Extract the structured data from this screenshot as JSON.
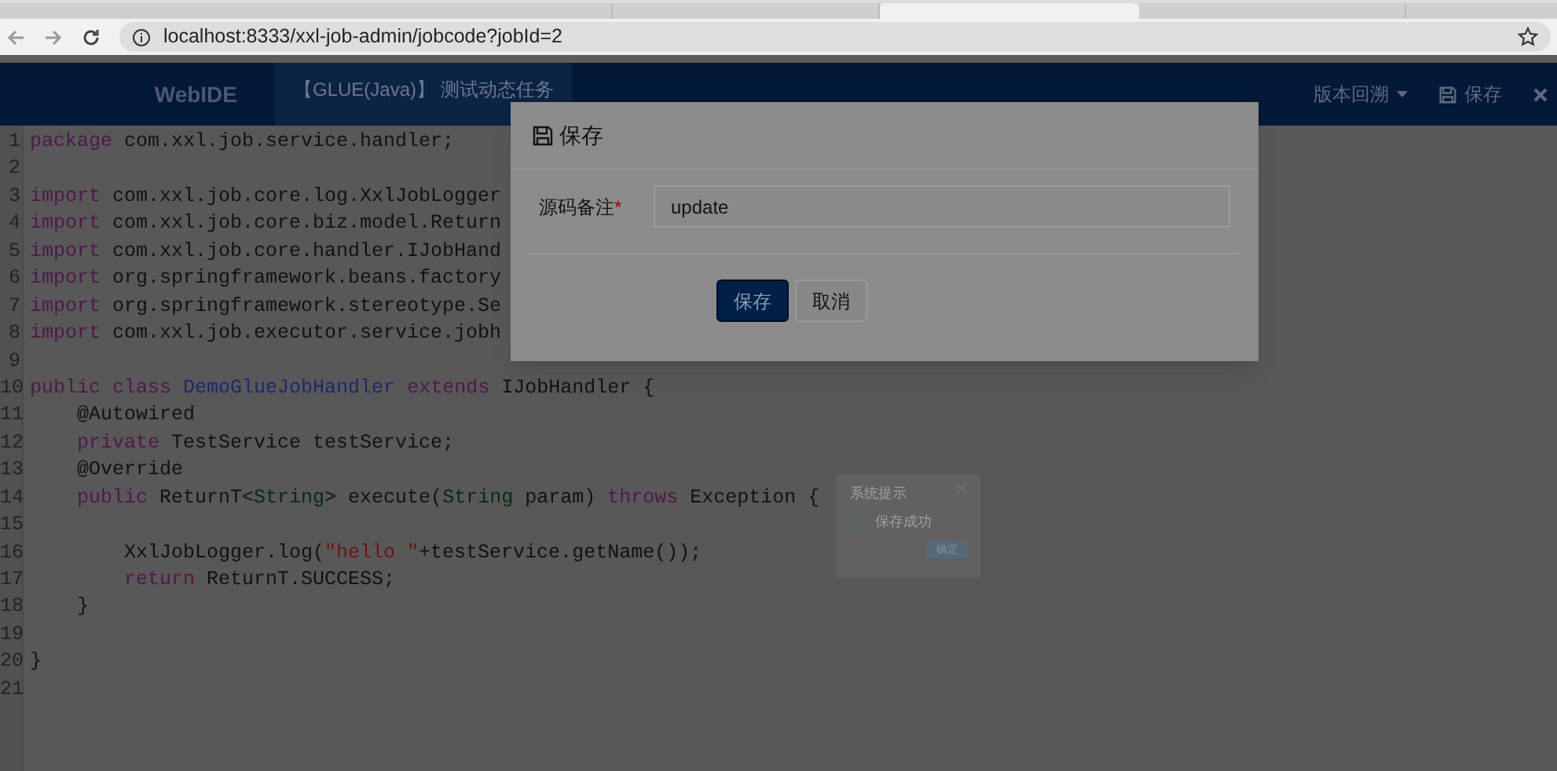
{
  "browser": {
    "url": "localhost:8333/xxl-job-admin/jobcode?jobId=2"
  },
  "header": {
    "brand": "WebIDE",
    "job_title": "【GLUE(Java)】 测试动态任务",
    "actions": [
      {
        "kind": "dropdown",
        "label": "版本回溯"
      },
      {
        "kind": "save",
        "label": "保存"
      },
      {
        "kind": "close"
      }
    ]
  },
  "code_lines": [
    {
      "number": "1",
      "tokens": [
        {
          "kind": "keyword",
          "text": "package"
        },
        {
          "kind": "plain",
          "text": " com.xxl.job.service.handler;"
        }
      ]
    },
    {
      "number": "2"
    },
    {
      "number": "3",
      "tokens": [
        {
          "kind": "keyword",
          "text": "import"
        },
        {
          "kind": "plain",
          "text": " com.xxl.job.core.log.XxlJobLogger"
        }
      ]
    },
    {
      "number": "4",
      "tokens": [
        {
          "kind": "keyword",
          "text": "import"
        },
        {
          "kind": "plain",
          "text": " com.xxl.job.core.biz.model.Return"
        }
      ]
    },
    {
      "number": "5",
      "tokens": [
        {
          "kind": "keyword",
          "text": "import"
        },
        {
          "kind": "plain",
          "text": " com.xxl.job.core.handler.IJobHand"
        }
      ]
    },
    {
      "number": "6",
      "tokens": [
        {
          "kind": "keyword",
          "text": "import"
        },
        {
          "kind": "plain",
          "text": " org.springframework.beans.factory"
        }
      ]
    },
    {
      "number": "7",
      "tokens": [
        {
          "kind": "keyword",
          "text": "import"
        },
        {
          "kind": "plain",
          "text": " org.springframework.stereotype.Se"
        }
      ]
    },
    {
      "number": "8",
      "tokens": [
        {
          "kind": "keyword",
          "text": "import"
        },
        {
          "kind": "plain",
          "text": " com.xxl.job.executor.service.jobh"
        }
      ]
    },
    {
      "number": "9"
    },
    {
      "number": "10",
      "tokens": [
        {
          "kind": "keyword",
          "text": "public class "
        },
        {
          "kind": "classname",
          "text": "DemoGlueJobHandler"
        },
        {
          "kind": "keyword",
          "text": " extends"
        },
        {
          "kind": "plain",
          "text": " IJobHandler {"
        }
      ]
    },
    {
      "number": "11",
      "tokens": [
        {
          "kind": "plain",
          "text": "    @Autowired"
        }
      ]
    },
    {
      "number": "12",
      "tokens": [
        {
          "kind": "keyword",
          "text": "    private"
        },
        {
          "kind": "plain",
          "text": " TestService testService;"
        }
      ]
    },
    {
      "number": "13",
      "tokens": [
        {
          "kind": "plain",
          "text": "    @Override"
        }
      ]
    },
    {
      "number": "14",
      "tokens": [
        {
          "kind": "keyword",
          "text": "    public"
        },
        {
          "kind": "plain",
          "text": " ReturnT<"
        },
        {
          "kind": "type",
          "text": "String"
        },
        {
          "kind": "plain",
          "text": "> execute("
        },
        {
          "kind": "type",
          "text": "String"
        },
        {
          "kind": "plain",
          "text": " param) "
        },
        {
          "kind": "keyword",
          "text": "throws"
        },
        {
          "kind": "plain",
          "text": " Exception {"
        }
      ]
    },
    {
      "number": "15"
    },
    {
      "number": "16",
      "tokens": [
        {
          "kind": "plain",
          "text": "        XxlJobLogger.log("
        },
        {
          "kind": "string",
          "text": "\"hello \""
        },
        {
          "kind": "plain",
          "text": "+testService.getName());"
        }
      ]
    },
    {
      "number": "17",
      "tokens": [
        {
          "kind": "keyword",
          "text": "        return"
        },
        {
          "kind": "plain",
          "text": " ReturnT.SUCCESS;"
        }
      ]
    },
    {
      "number": "18",
      "tokens": [
        {
          "kind": "plain",
          "text": "    }"
        }
      ]
    },
    {
      "number": "19"
    },
    {
      "number": "20",
      "tokens": [
        {
          "kind": "plain",
          "text": "}"
        }
      ]
    },
    {
      "number": "21"
    }
  ],
  "toast": {
    "title": "系统提示",
    "message": "保存成功",
    "button": "确定"
  },
  "modal": {
    "title": "保存",
    "field_label": "源码备注",
    "required_mark": "*",
    "value": "update",
    "buttons": [
      {
        "kind": "primary",
        "label": "保存"
      },
      {
        "kind": "default",
        "label": "取消"
      }
    ]
  }
}
